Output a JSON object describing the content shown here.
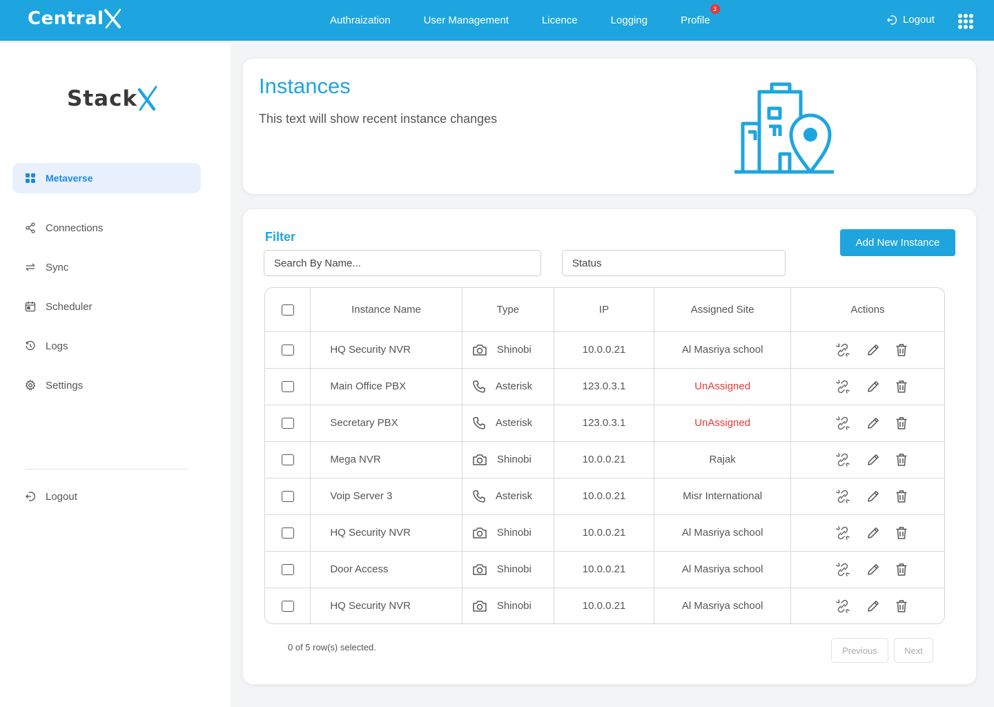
{
  "header": {
    "brand": "Central",
    "nav": [
      {
        "label": "Authraization"
      },
      {
        "label": "User Management"
      },
      {
        "label": "Licence"
      },
      {
        "label": "Logging"
      },
      {
        "label": "Profile",
        "badge": "3"
      }
    ],
    "logout_label": "Logout",
    "apps_icon": "grid-dots-icon"
  },
  "sidebar": {
    "logo": "Stack",
    "items": [
      {
        "label": "Metaverse",
        "icon": "dashboard-grid-icon",
        "active": true
      },
      {
        "label": "Connections",
        "icon": "share-nodes-icon"
      },
      {
        "label": "Sync",
        "icon": "sync-arrows-icon"
      },
      {
        "label": "Scheduler",
        "icon": "calendar-icon"
      },
      {
        "label": "Logs",
        "icon": "history-icon"
      },
      {
        "label": "Settings",
        "icon": "gear-icon"
      }
    ],
    "logout_label": "Logout"
  },
  "hero": {
    "title": "Instances",
    "subtitle": "This text will show recent instance changes",
    "illustration": "building-location-icon"
  },
  "filter": {
    "label": "Filter",
    "search_placeholder": "Search By Name...",
    "status_placeholder": "Status",
    "add_button": "Add New Instance"
  },
  "table": {
    "columns": [
      "Instance Name",
      "Type",
      "IP",
      "Assigned Site",
      "Actions"
    ],
    "rows": [
      {
        "name": "HQ Security NVR",
        "type": "Shinobi",
        "type_icon": "camera-icon",
        "ip": "10.0.0.21",
        "site": "Al Masriya school",
        "unassigned": false
      },
      {
        "name": "Main Office PBX",
        "type": "Asterisk",
        "type_icon": "phone-icon",
        "ip": "123.0.3.1",
        "site": "UnAssigned",
        "unassigned": true
      },
      {
        "name": "Secretary  PBX",
        "type": "Asterisk",
        "type_icon": "phone-icon",
        "ip": "123.0.3.1",
        "site": "UnAssigned",
        "unassigned": true
      },
      {
        "name": "Mega  NVR",
        "type": "Shinobi",
        "type_icon": "camera-icon",
        "ip": "10.0.0.21",
        "site": "Rajak",
        "unassigned": false
      },
      {
        "name": "Voip Server 3",
        "type": "Asterisk",
        "type_icon": "phone-icon",
        "ip": "10.0.0.21",
        "site": "Misr International",
        "unassigned": false
      },
      {
        "name": "HQ Security NVR",
        "type": "Shinobi",
        "type_icon": "camera-icon",
        "ip": "10.0.0.21",
        "site": "Al Masriya school",
        "unassigned": false
      },
      {
        "name": "Door Access",
        "type": "Shinobi",
        "type_icon": "camera-icon",
        "ip": "10.0.0.21",
        "site": "Al Masriya school",
        "unassigned": false
      },
      {
        "name": "HQ Security NVR",
        "type": "Shinobi",
        "type_icon": "camera-icon",
        "ip": "10.0.0.21",
        "site": "Al Masriya school",
        "unassigned": false
      }
    ]
  },
  "footer": {
    "selected_info": "0 of 5 row(s) selected.",
    "previous": "Previous",
    "next": "Next"
  },
  "colors": {
    "primary": "#1ea5e0",
    "danger": "#e53935",
    "active_bg": "#e8f1fd"
  }
}
